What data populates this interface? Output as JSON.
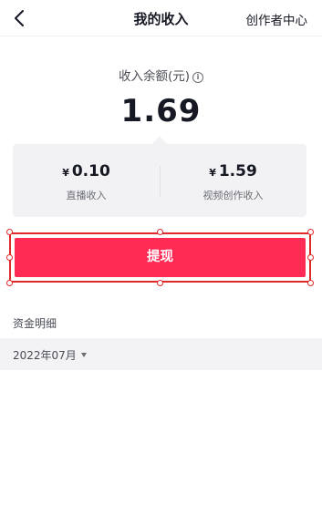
{
  "nav": {
    "title": "我的收入",
    "right_link": "创作者中心"
  },
  "balance": {
    "label": "收入余额(元)",
    "info_glyph": "i",
    "value": "1.69"
  },
  "breakdown": {
    "currency_symbol": "¥",
    "items": [
      {
        "amount": "0.10",
        "label": "直播收入"
      },
      {
        "amount": "1.59",
        "label": "视频创作收入"
      }
    ]
  },
  "withdraw": {
    "label": "提现"
  },
  "details": {
    "title": "资金明细",
    "month": "2022年07月"
  },
  "colors": {
    "accent": "#fe2c55",
    "selection_outline": "#e02a2a",
    "card_bg": "#f2f2f4"
  },
  "icons": {
    "back": "chevron-left-icon",
    "info": "info-circle-icon",
    "dropdown": "caret-down-icon"
  }
}
